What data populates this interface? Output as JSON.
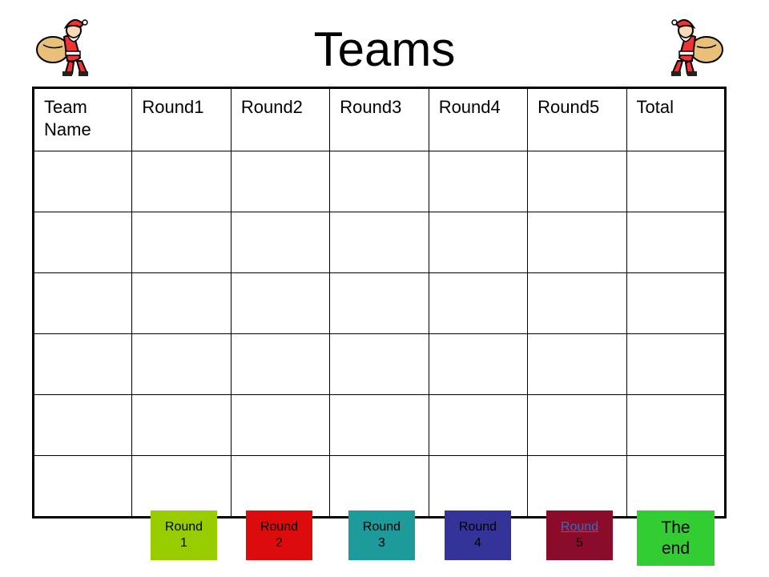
{
  "slide": {
    "title": "Teams"
  },
  "table": {
    "headers": [
      "Team Name",
      "Round1",
      "Round2",
      "Round3",
      "Round4",
      "Round5",
      "Total"
    ],
    "rows": [
      [
        "",
        "",
        "",
        "",
        "",
        "",
        ""
      ],
      [
        "",
        "",
        "",
        "",
        "",
        "",
        ""
      ],
      [
        "",
        "",
        "",
        "",
        "",
        "",
        ""
      ],
      [
        "",
        "",
        "",
        "",
        "",
        "",
        ""
      ],
      [
        "",
        "",
        "",
        "",
        "",
        "",
        ""
      ],
      [
        "",
        "",
        "",
        "",
        "",
        "",
        ""
      ]
    ]
  },
  "nav": {
    "round1": [
      "Round",
      "1"
    ],
    "round2": [
      "Round",
      "2"
    ],
    "round3": [
      "Round",
      "3"
    ],
    "round4": [
      "Round",
      "4"
    ],
    "round5": [
      "Round",
      "5"
    ],
    "end": [
      "The",
      "end"
    ]
  },
  "colors": {
    "round1": "#99cc00",
    "round2": "#dd0b0b",
    "round3": "#1d9a9a",
    "round4": "#333399",
    "round5": "#8a0b2a",
    "end": "#33cc33"
  },
  "icons": {
    "santa_left": "santa-icon",
    "santa_right": "santa-icon"
  }
}
